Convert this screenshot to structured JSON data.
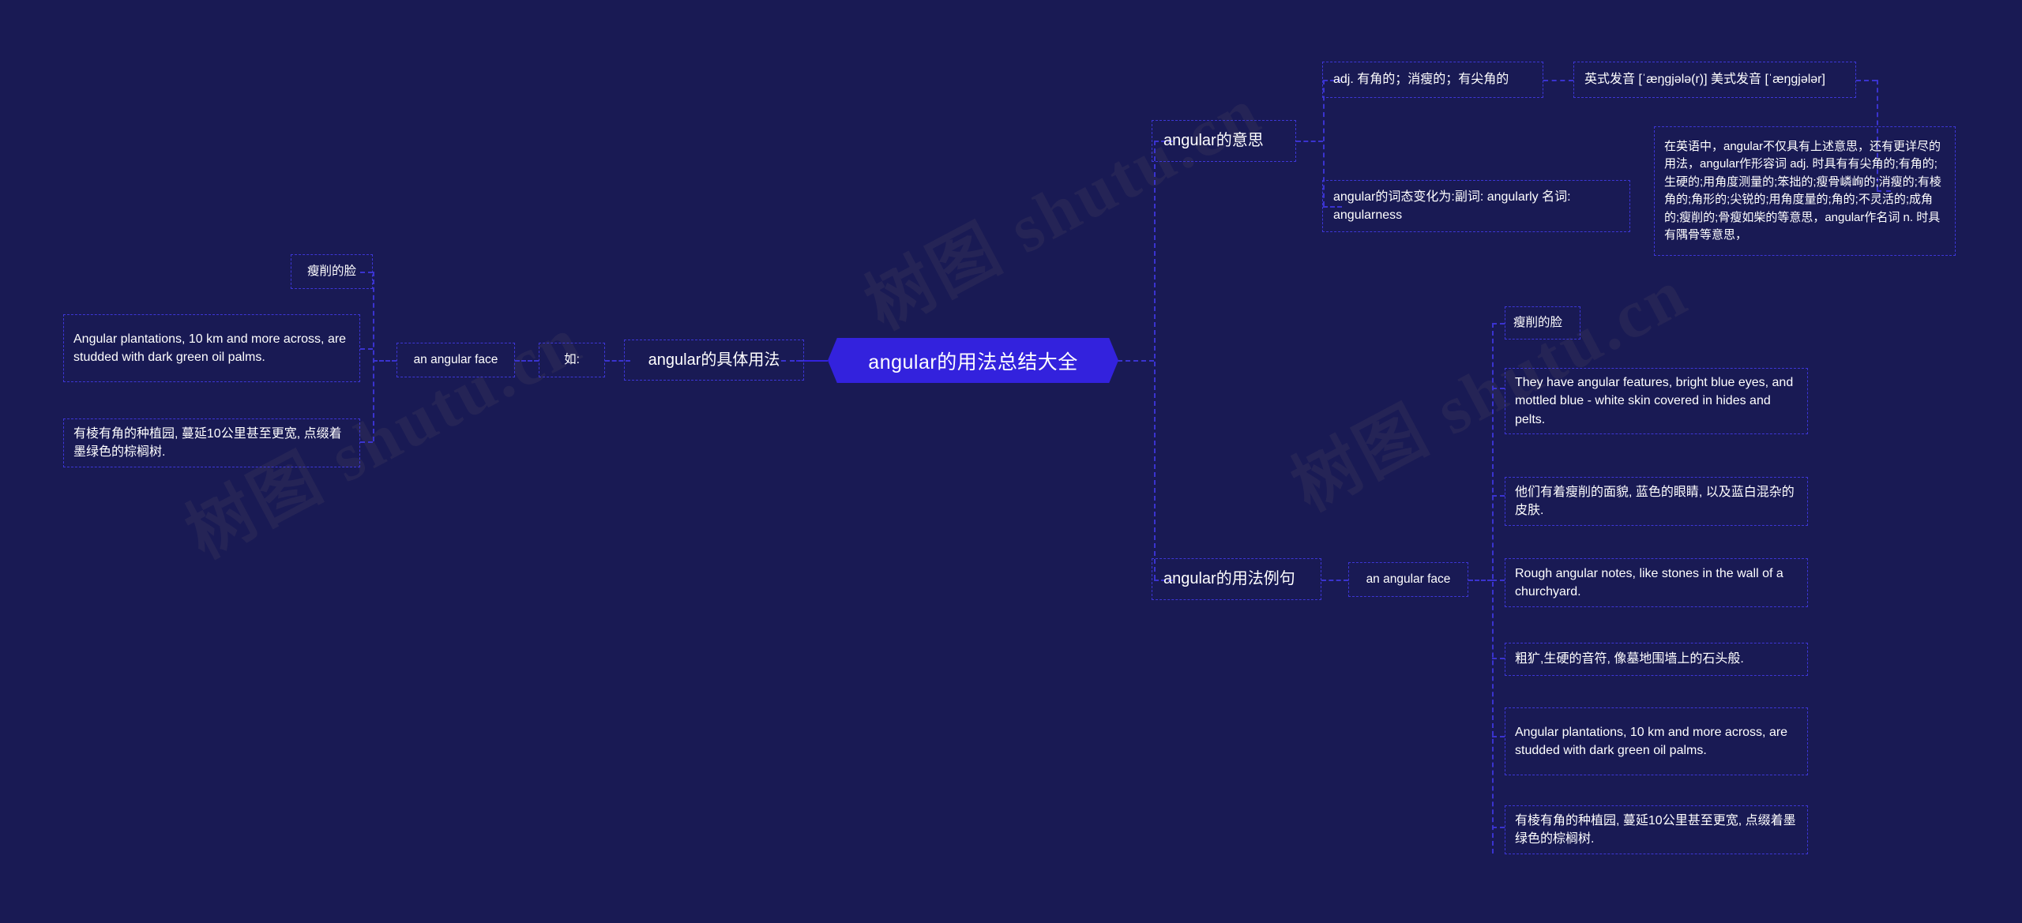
{
  "meta": {
    "background_color": "#191a54",
    "accent_color": "#3322dd",
    "border_color": "#3d36d6",
    "text_color": "#ffffff",
    "watermark": "树图 shutu.cn"
  },
  "central": {
    "label": "angular的用法总结大全"
  },
  "branches": {
    "meaning": {
      "label": "angular的意思",
      "children": [
        {
          "label": "adj. 有角的；消瘦的；有尖角的"
        },
        {
          "label": "英式发音 [ˈæŋɡjələ(r)] 美式发音 [ˈæŋɡjələr]"
        },
        {
          "label": "angular的词态变化为:副词: angularly 名词: angularness"
        },
        {
          "label": "在英语中，angular不仅具有上述意思，还有更详尽的用法，angular作形容词 adj. 时具有有尖角的;有角的;生硬的;用角度测量的;笨拙的;瘦骨嶙峋的;消瘦的;有棱角的;角形的;尖锐的;用角度量的;角的;不灵活的;成角的;瘦削的;骨瘦如柴的等意思，angular作名词 n. 时具有隅骨等意思，"
        }
      ]
    },
    "usage": {
      "label": "angular的具体用法",
      "connector_label": "如:",
      "phrase": "an angular face",
      "phrase_gloss": "瘦削的脸",
      "example_en": "Angular plantations, 10 km and more across, are studded with dark green oil palms.",
      "example_zh": "有棱有角的种植园, 蔓延10公里甚至更宽, 点缀着墨绿色的棕榈树."
    },
    "examples": {
      "label": "angular的用法例句",
      "phrase": "an angular face",
      "items": [
        {
          "label": "瘦削的脸"
        },
        {
          "label": "They have angular features, bright blue eyes, and mottled blue - white skin covered in hides and pelts."
        },
        {
          "label": "他们有着瘦削的面貌, 蓝色的眼睛, 以及蓝白混杂的皮肤."
        },
        {
          "label": "Rough angular notes, like stones in the wall of a churchyard."
        },
        {
          "label": "粗犷,生硬的音符, 像墓地围墙上的石头般."
        },
        {
          "label": "Angular plantations, 10 km and more across, are studded with dark green oil palms."
        },
        {
          "label": "有棱有角的种植园, 蔓延10公里甚至更宽, 点缀着墨绿色的棕榈树."
        }
      ]
    }
  }
}
